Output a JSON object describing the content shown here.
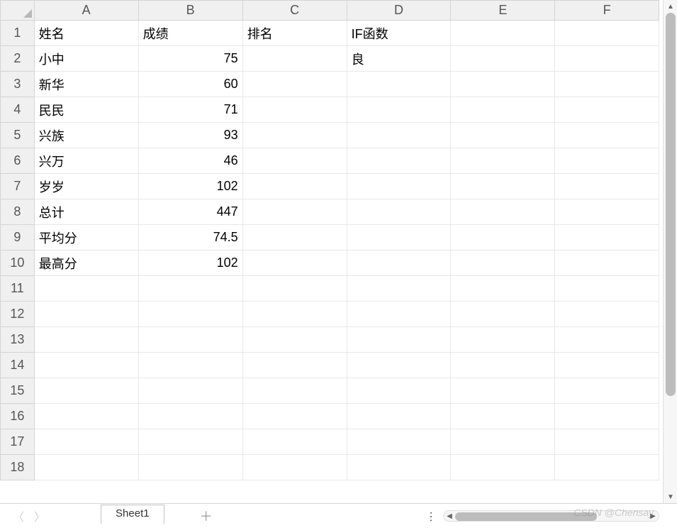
{
  "columns": [
    "A",
    "B",
    "C",
    "D",
    "E",
    "F"
  ],
  "row_count": 18,
  "cells": {
    "r1": {
      "A": "姓名",
      "B": "成绩",
      "C": "排名",
      "D": "IF函数"
    },
    "r2": {
      "A": "小中",
      "B": "75",
      "D": "良"
    },
    "r3": {
      "A": "新华",
      "B": "60"
    },
    "r4": {
      "A": "民民",
      "B": "71"
    },
    "r5": {
      "A": "兴族",
      "B": "93"
    },
    "r6": {
      "A": "兴万",
      "B": "46"
    },
    "r7": {
      "A": "岁岁",
      "B": "102"
    },
    "r8": {
      "A": "总计",
      "B": "447"
    },
    "r9": {
      "A": "平均分",
      "B": "74.5"
    },
    "r10": {
      "A": "最高分",
      "B": "102"
    }
  },
  "alignment": {
    "B_right_rows": [
      2,
      3,
      4,
      5,
      6,
      7,
      8,
      9,
      10
    ]
  },
  "tabs": {
    "active": "Sheet1"
  },
  "watermark": "CSDN @Chensay."
}
